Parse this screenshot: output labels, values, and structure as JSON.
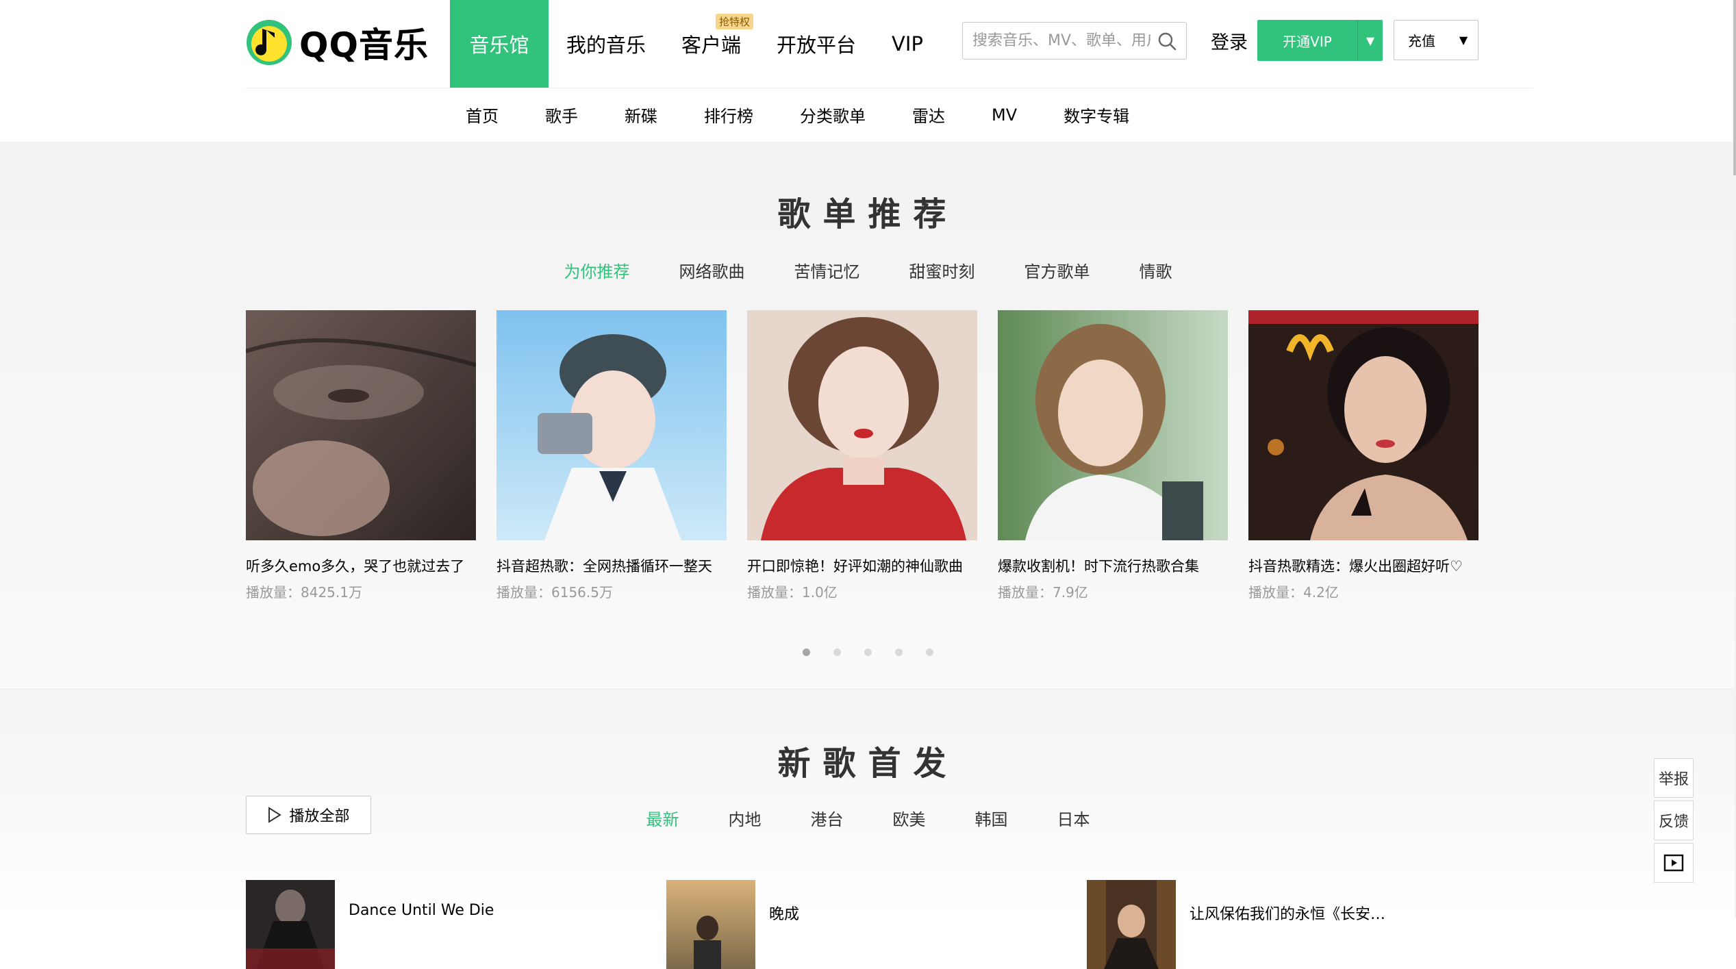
{
  "header": {
    "logo_text": "QQ音乐",
    "main_nav": [
      {
        "label": "音乐馆",
        "active": true
      },
      {
        "label": "我的音乐",
        "active": false
      },
      {
        "label": "客户端",
        "active": false,
        "badge": "抢特权"
      },
      {
        "label": "开放平台",
        "active": false
      },
      {
        "label": "VIP",
        "active": false
      }
    ],
    "search_placeholder": "搜索音乐、MV、歌单、用户",
    "login_label": "登录",
    "vip_button_label": "开通VIP",
    "recharge_label": "充值",
    "sub_nav": [
      "首页",
      "歌手",
      "新碟",
      "排行榜",
      "分类歌单",
      "雷达",
      "MV",
      "数字专辑"
    ]
  },
  "playlist_section": {
    "title": "歌单推荐",
    "tabs": [
      {
        "label": "为你推荐",
        "active": true
      },
      {
        "label": "网络歌曲",
        "active": false
      },
      {
        "label": "苦情记忆",
        "active": false
      },
      {
        "label": "甜蜜时刻",
        "active": false
      },
      {
        "label": "官方歌单",
        "active": false
      },
      {
        "label": "情歌",
        "active": false
      }
    ],
    "cards": [
      {
        "title": "听多久emo多久，哭了也就过去了",
        "plays": "播放量：8425.1万"
      },
      {
        "title": "抖音超热歌：全网热播循环一整天",
        "plays": "播放量：6156.5万"
      },
      {
        "title": "开口即惊艳！好评如潮的神仙歌曲",
        "plays": "播放量：1.0亿"
      },
      {
        "title": "爆款收割机！时下流行热歌合集",
        "plays": "播放量：7.9亿"
      },
      {
        "title": "抖音热歌精选：爆火出圈超好听♡",
        "plays": "播放量：4.2亿"
      }
    ],
    "carousel_pages": 5,
    "carousel_active": 0
  },
  "newsong_section": {
    "title": "新歌首发",
    "play_all_label": "播放全部",
    "tabs": [
      {
        "label": "最新",
        "active": true
      },
      {
        "label": "内地",
        "active": false
      },
      {
        "label": "港台",
        "active": false
      },
      {
        "label": "欧美",
        "active": false
      },
      {
        "label": "韩国",
        "active": false
      },
      {
        "label": "日本",
        "active": false
      }
    ],
    "songs": [
      {
        "title": "Dance Until We Die"
      },
      {
        "title": "晚成"
      },
      {
        "title": "让风保佑我们的永恒《长安二..."
      }
    ]
  },
  "side_widgets": {
    "report_label": "举报",
    "feedback_label": "反馈"
  },
  "colors": {
    "accent": "#31c27c",
    "text_secondary": "#999999"
  }
}
